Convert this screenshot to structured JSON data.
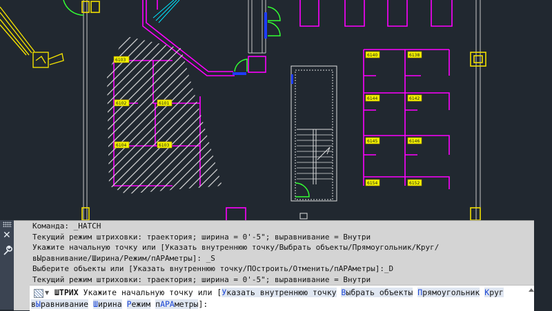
{
  "drawing": {
    "room_tags": [
      "6103",
      "6102",
      "6101",
      "6104",
      "6103",
      "6140",
      "6138",
      "6144",
      "6142",
      "6145",
      "6146",
      "6154",
      "6152"
    ],
    "colors": {
      "background": "#212830",
      "walls": "#ff00ff",
      "hatch": "#dcdcdc",
      "doors": "#33ff33",
      "columns": "#ffff00",
      "stair": "#e6e6e6",
      "cyan": "#00ffff",
      "blue": "#1e3cff"
    }
  },
  "command_window": {
    "history": [
      "Команда: _HATCH",
      "Текущий режим штриховки: траектория; ширина = 0'-5\"; выравнивание = Внутри",
      "Укажите начальную точку или [Указать внутреннюю точку/Выбрать объекты/Прямоугольник/Круг/",
      "вЫравнивание/Ширина/Режим/пАРАметры]: _S",
      "Выберите объекты или [Указать внутреннюю точку/ПОстроить/Отменить/пАРАметры]:_D",
      "Текущий режим штриховки: траектория; ширина = 0'-5\"; выравнивание = Внутри"
    ],
    "prompt": {
      "command": "ШТРИХ",
      "text": "Укажите начальную точку или [",
      "end": "]:",
      "options": [
        {
          "key": "У",
          "rest": "казать внутреннюю точку"
        },
        {
          "key": "В",
          "rest": "ыбрать объекты"
        },
        {
          "key": "П",
          "rest": "рямоугольник"
        },
        {
          "key": "К",
          "rest": "руг"
        },
        {
          "pre": "в",
          "key": "Ы",
          "rest": "равнивание"
        },
        {
          "key": "Ш",
          "rest": "ирина"
        },
        {
          "key": "Р",
          "rest": "ежим"
        },
        {
          "pre": "п",
          "key": "АРА",
          "rest": "метры"
        }
      ]
    },
    "icons": [
      "grip-icon",
      "close-icon",
      "wrench-icon",
      "hatch-icon",
      "dropdown-arrow-icon",
      "scroll-up-icon"
    ]
  }
}
